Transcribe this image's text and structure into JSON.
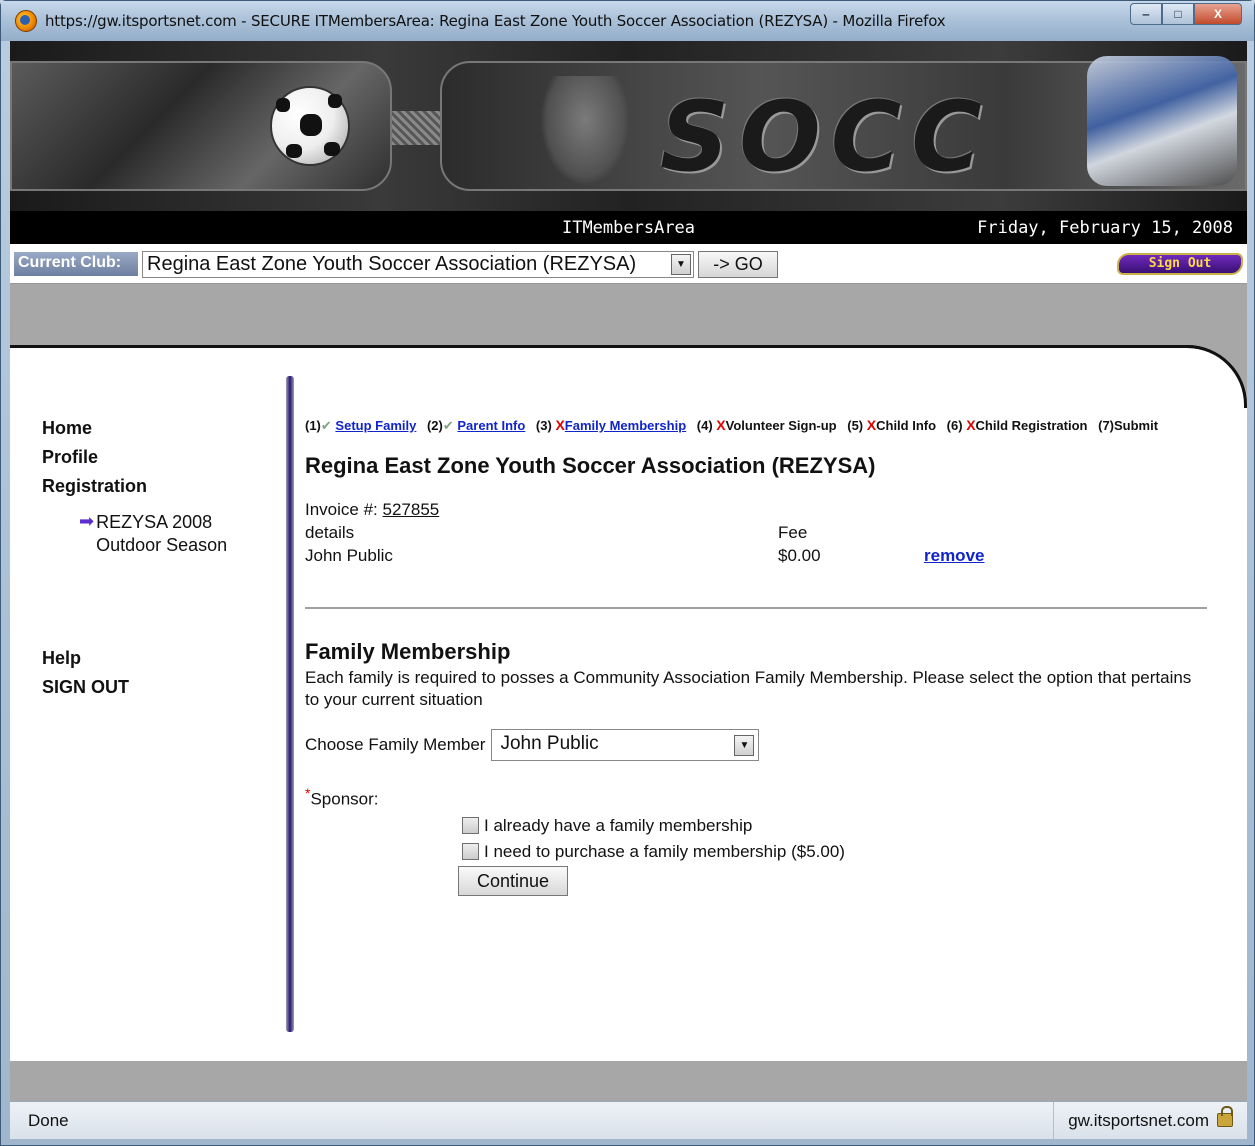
{
  "window": {
    "title": "https://gw.itsportsnet.com - SECURE ITMembersArea: Regina East Zone Youth Soccer Association (REZYSA) - Mozilla Firefox",
    "minimize": "‒",
    "maximize": "□",
    "close": "X"
  },
  "banner": {
    "word": "SOCC"
  },
  "header": {
    "app_name": "ITMembersArea",
    "date": "Friday, February 15, 2008"
  },
  "clubbar": {
    "label": "Current Club:",
    "selected_club": "Regina East Zone Youth Soccer Association (REZYSA)",
    "go_label": "-> GO",
    "sign_out_label": "Sign Out"
  },
  "sidebar": {
    "home": "Home",
    "profile": "Profile",
    "registration": "Registration",
    "season_arrow": "➡",
    "season_line1": "REZYSA 2008",
    "season_line2": "Outdoor Season",
    "help": "Help",
    "sign_out": "SIGN OUT"
  },
  "steps": [
    {
      "num": "(1)",
      "mark": "✔",
      "label": "Setup Family"
    },
    {
      "num": "(2)",
      "mark": "✔",
      "label": "Parent Info"
    },
    {
      "num": "(3)",
      "mark": "X",
      "label": "Family Membership"
    },
    {
      "num": "(4)",
      "mark": "X",
      "label": "Volunteer Sign-up"
    },
    {
      "num": "(5)",
      "mark": "X",
      "label": "Child Info"
    },
    {
      "num": "(6)",
      "mark": "X",
      "label": "Child Registration"
    },
    {
      "num": "(7)",
      "mark": "",
      "label": "Submit"
    }
  ],
  "org_title": "Regina East Zone Youth Soccer Association (REZYSA)",
  "invoice": {
    "label": "Invoice #:",
    "number": "527855",
    "col_details": "details",
    "col_fee": "Fee",
    "row_name": "John Public",
    "row_fee": "$0.00",
    "row_action": "remove"
  },
  "family_membership": {
    "title": "Family Membership",
    "description": "Each family is required to posses a Community Association Family Membership. Please select the option that pertains to your current situation",
    "choose_label": "Choose Family Member",
    "selected_member": "John Public",
    "required_mark": "*",
    "sponsor_label": "Sponsor:",
    "option1": "I already have a family membership",
    "option2": "I need to purchase a family membership ($5.00)",
    "continue_label": "Continue"
  },
  "statusbar": {
    "status": "Done",
    "domain": "gw.itsportsnet.com"
  },
  "colors": {
    "link": "#1024c9",
    "error_x": "#e00000",
    "nav_arrow": "#5a2ecf",
    "sign_out_bg": "#3a0f74"
  }
}
